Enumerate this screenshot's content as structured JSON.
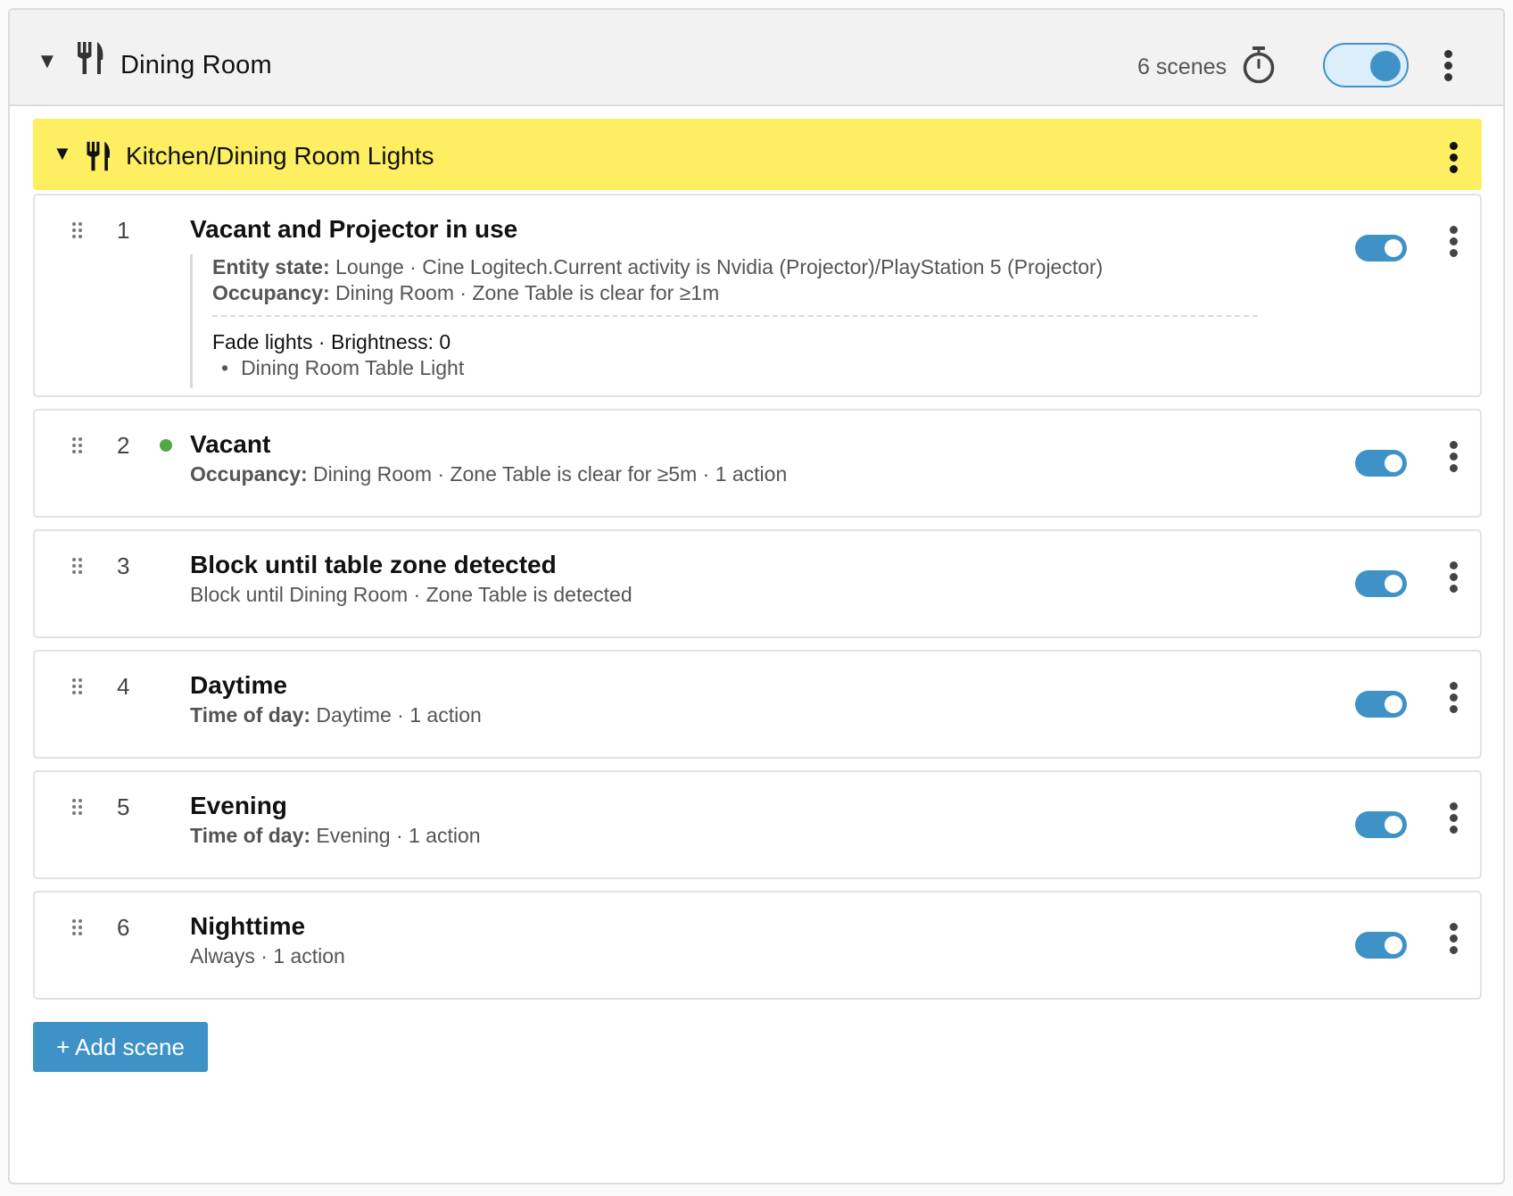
{
  "room": {
    "title": "Dining Room",
    "scene_count": "6 scenes",
    "enabled": true
  },
  "group": {
    "title": "Kitchen/Dining Room Lights",
    "color": "#fdee62"
  },
  "scenes": [
    {
      "number": "1",
      "title": "Vacant and Projector in use",
      "active": false,
      "conditions": [
        {
          "label": "Entity state:",
          "text": " Lounge · Cine Logitech.Current activity is Nvidia (Projector)/PlayStation 5 (Projector)"
        },
        {
          "label": "Occupancy:",
          "text": " Dining Room · Zone Table is clear for ≥1m"
        }
      ],
      "action": "Fade lights · Brightness: 0",
      "action_target": "Dining Room Table Light",
      "enabled": true
    },
    {
      "number": "2",
      "title": "Vacant",
      "active": true,
      "summary_label": "Occupancy:",
      "summary": " Dining Room · Zone Table is clear for ≥5m · 1 action",
      "enabled": true
    },
    {
      "number": "3",
      "title": "Block until table zone detected",
      "active": false,
      "summary_label": "",
      "summary": "Block until Dining Room · Zone Table is detected",
      "enabled": true
    },
    {
      "number": "4",
      "title": "Daytime",
      "active": false,
      "summary_label": "Time of day:",
      "summary": " Daytime · 1 action",
      "enabled": true
    },
    {
      "number": "5",
      "title": "Evening",
      "active": false,
      "summary_label": "Time of day:",
      "summary": " Evening · 1 action",
      "enabled": true
    },
    {
      "number": "6",
      "title": "Nighttime",
      "active": false,
      "summary_label": "",
      "summary": "Always · 1 action",
      "enabled": true
    }
  ],
  "add_scene_label": "+ Add scene",
  "colors": {
    "accent": "#3f92c6",
    "active_dot": "#54a849",
    "header_bg": "#f2f2f2"
  },
  "icons": {
    "collapse": "caret-down-icon",
    "room": "fork-knife-icon",
    "timer": "stopwatch-icon",
    "menu": "more-vertical-icon",
    "drag": "drag-handle-icon"
  }
}
